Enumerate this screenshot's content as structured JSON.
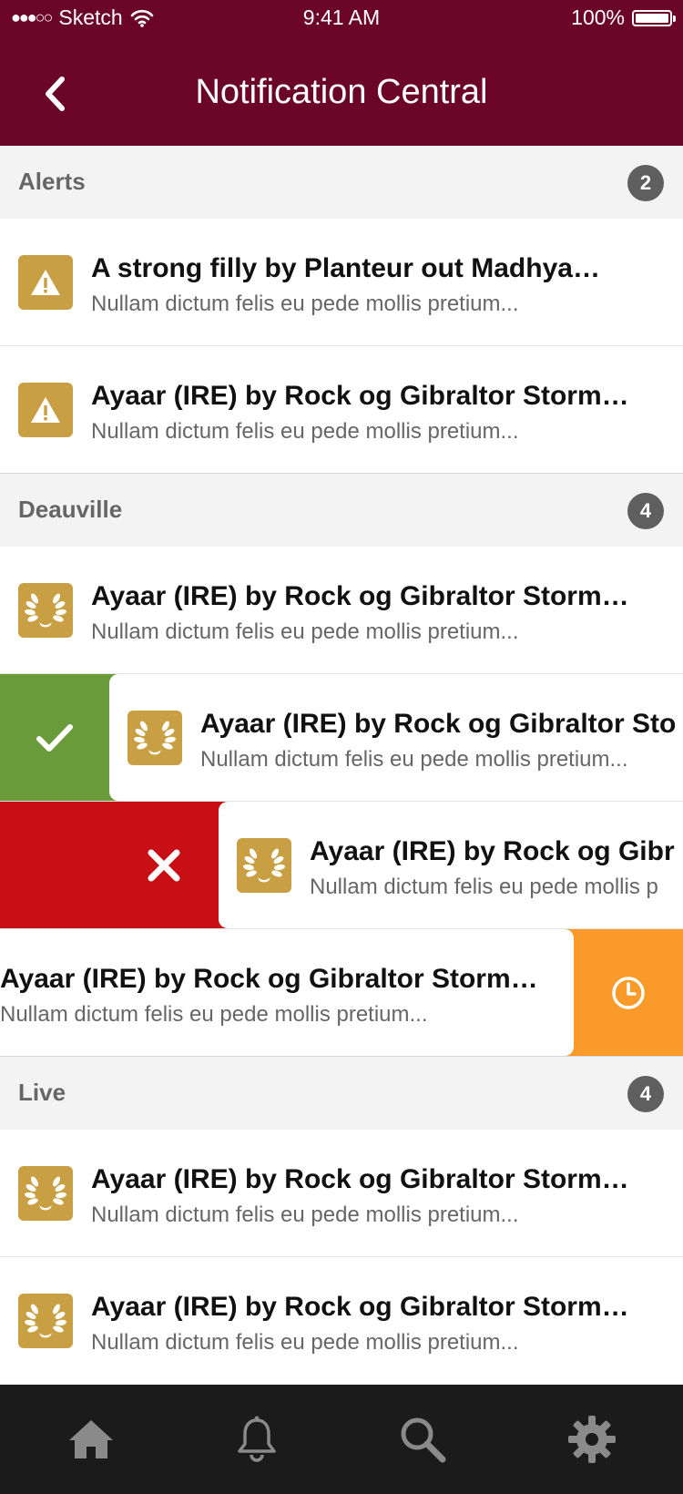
{
  "status_bar": {
    "signal": "●●●○○",
    "carrier": "Sketch",
    "time": "9:41 AM",
    "battery_percent": "100%"
  },
  "header": {
    "title": "Notification Central",
    "back_icon": "chevron-left-icon"
  },
  "colors": {
    "header_bg": "#6b0628",
    "icon_gold": "#c99f44",
    "accept_green": "#6a9b3b",
    "delete_red": "#c90f16",
    "snooze_orange": "#f99a2b",
    "tabbar_bg": "#1b1b1b"
  },
  "sections": [
    {
      "label": "Alerts",
      "count": "2",
      "items": [
        {
          "title": "A strong filly by Planteur out Madhya…",
          "subtitle": "Nullam dictum felis eu pede mollis pretium...",
          "icon": "warning-icon"
        },
        {
          "title": "Ayaar (IRE) by Rock og Gibraltor Storm…",
          "subtitle": "Nullam dictum felis eu pede mollis pretium...",
          "icon": "warning-icon"
        }
      ]
    },
    {
      "label": "Deauville",
      "count": "4",
      "items": [
        {
          "title": "Ayaar (IRE) by Rock og Gibraltor Storm…",
          "subtitle": "Nullam dictum felis eu pede mollis pretium...",
          "icon": "laurel-icon"
        },
        {
          "title": "Ayaar (IRE) by Rock og Gibraltor Sto",
          "subtitle": "Nullam dictum felis eu pede mollis pretium...",
          "icon": "laurel-icon",
          "swipe_action": "checkmark-icon"
        },
        {
          "title": "Ayaar (IRE) by Rock og Gibr",
          "subtitle": "Nullam dictum felis eu pede mollis p",
          "icon": "laurel-icon",
          "swipe_action": "close-icon"
        },
        {
          "title": "Ayaar (IRE) by Rock og Gibraltor Storm…",
          "subtitle": "Nullam dictum felis eu pede mollis pretium...",
          "swipe_action": "clock-icon"
        }
      ]
    },
    {
      "label": "Live",
      "count": "4",
      "items": [
        {
          "title": "Ayaar (IRE) by Rock og Gibraltor Storm…",
          "subtitle": "Nullam dictum felis eu pede mollis pretium...",
          "icon": "laurel-icon"
        },
        {
          "title": "Ayaar (IRE) by Rock og Gibraltor Storm…",
          "subtitle": "Nullam dictum felis eu pede mollis pretium...",
          "icon": "laurel-icon"
        }
      ]
    }
  ],
  "tabbar": {
    "tabs": [
      {
        "icon": "home-icon"
      },
      {
        "icon": "bell-icon"
      },
      {
        "icon": "search-icon"
      },
      {
        "icon": "gear-icon"
      }
    ]
  }
}
